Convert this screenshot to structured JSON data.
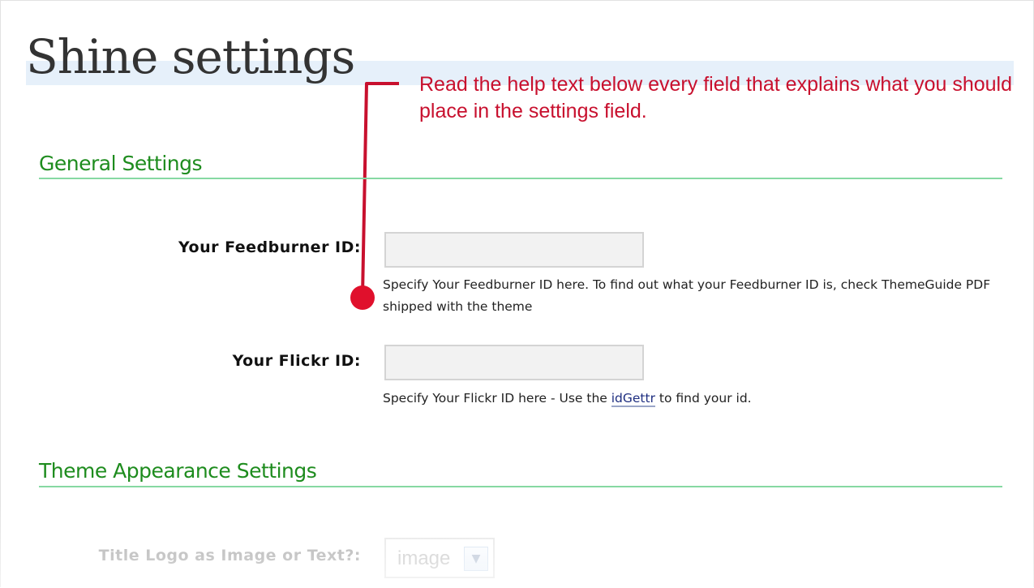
{
  "page": {
    "title": "Shine settings"
  },
  "annotation": {
    "text": "Read the help text below every field that explains what you should place in the settings field.",
    "color": "#c8102e"
  },
  "sections": {
    "general": {
      "heading": "General Settings",
      "feedburner": {
        "label": "Your Feedburner ID:",
        "value": "",
        "help": "Specify Your Feedburner ID here. To find out what your Feedburner ID is, check ThemeGuide PDF shipped with the theme"
      },
      "flickr": {
        "label": "Your Flickr ID:",
        "value": "",
        "help_before": "Specify Your Flickr ID here - Use the ",
        "help_link": "idGettr",
        "help_after": " to find your id."
      }
    },
    "appearance": {
      "heading": "Theme Appearance Settings",
      "title_logo": {
        "label": "Title Logo as Image or Text?:",
        "selected": "image",
        "arrow_icon": "chevron-down-icon"
      }
    }
  },
  "colors": {
    "section_heading": "#1e8c1e",
    "section_rule": "#86d9a2",
    "title_band": "#e6f0fa",
    "link": "#1e2e80"
  }
}
